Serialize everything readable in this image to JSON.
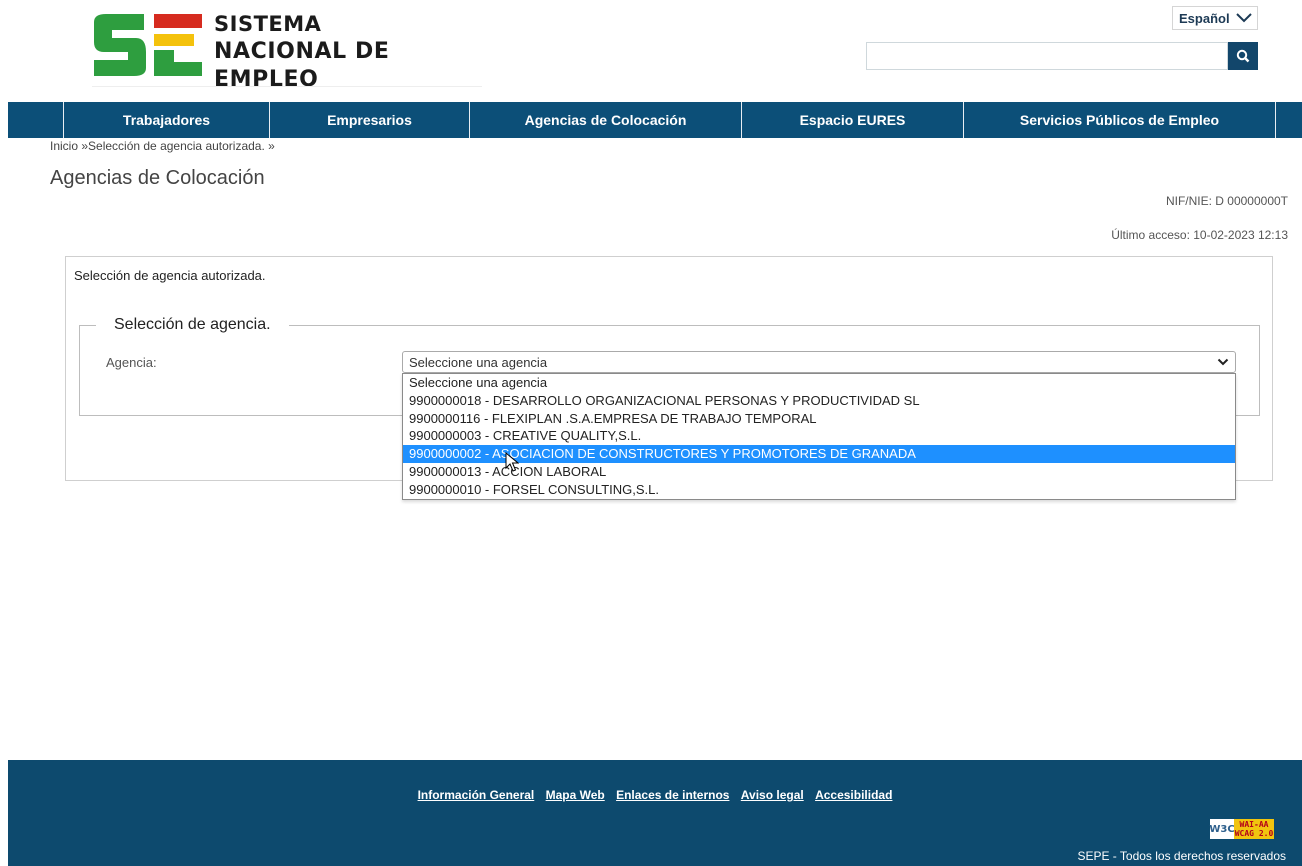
{
  "header": {
    "logo_line1": "SISTEMA",
    "logo_line2": "NACIONAL DE EMPLEO",
    "language": "Español",
    "search_placeholder": "",
    "search_icon": "search-icon"
  },
  "nav": {
    "items": [
      {
        "label": "Trabajadores"
      },
      {
        "label": "Empresarios"
      },
      {
        "label": "Agencias de Colocación"
      },
      {
        "label": "Espacio EURES"
      },
      {
        "label": "Servicios Públicos de Empleo"
      }
    ]
  },
  "breadcrumb": "Inicio »Selección de agencia autorizada. »",
  "page": {
    "title": "Agencias de Colocación",
    "nif": "NIF/NIE: D 00000000T",
    "last_access": "Último acceso: 10-02-2023 12:13"
  },
  "panel": {
    "title": "Selección de agencia autorizada.",
    "fieldset_legend": "Selección de agencia.",
    "agency_label": "Agencia:",
    "select_value": "Seleccione una agencia",
    "options": [
      {
        "label": "Seleccione una agencia"
      },
      {
        "label": "9900000018 - DESARROLLO ORGANIZACIONAL PERSONAS Y PRODUCTIVIDAD SL"
      },
      {
        "label": "9900000116 - FLEXIPLAN .S.A.EMPRESA DE TRABAJO TEMPORAL"
      },
      {
        "label": "9900000003 - CREATIVE QUALITY,S.L."
      },
      {
        "label": "9900000002 - ASOCIACION DE CONSTRUCTORES Y PROMOTORES DE GRANADA"
      },
      {
        "label": "9900000013 - ACCION LABORAL"
      },
      {
        "label": "9900000010 - FORSEL CONSULTING,S.L."
      }
    ],
    "highlighted_option_index": 4
  },
  "footer": {
    "links": [
      {
        "label": "Información General"
      },
      {
        "label": "Mapa Web"
      },
      {
        "label": "Enlaces de internos"
      },
      {
        "label": "Aviso legal"
      },
      {
        "label": "Accesibilidad"
      }
    ],
    "badge_w3c": "W3C",
    "badge_wai_line1": "WAI-AA",
    "badge_wai_line2": "WCAG 2.0",
    "rights": "SEPE - Todos los derechos reservados"
  },
  "colors": {
    "nav_bg": "#0c4f78",
    "footer_bg": "#0d4a6e",
    "highlight": "#1e90ff",
    "logo_green": "#2e9e3f",
    "logo_red": "#d62b1f",
    "logo_yellow": "#f4c20d"
  }
}
